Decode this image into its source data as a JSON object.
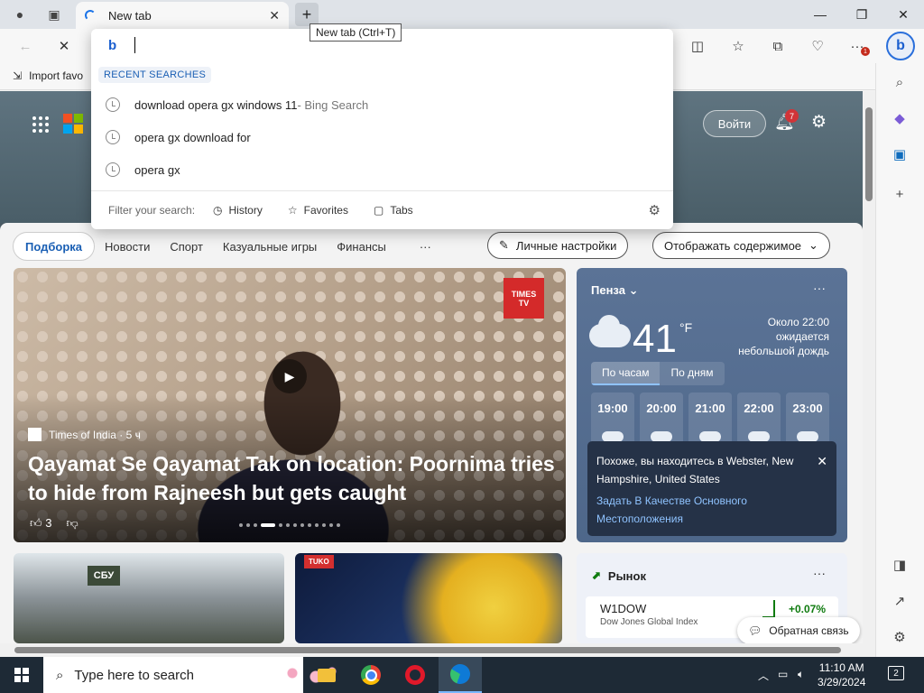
{
  "browser": {
    "tab_title": "New tab",
    "tooltip": "New tab (Ctrl+T)",
    "extensions_badge": "1"
  },
  "favorites_bar": {
    "import_label": "Import favo"
  },
  "omnibox": {
    "recent_heading": "RECENT SEARCHES",
    "suggestions": [
      {
        "text": "download opera gx windows 11",
        "suffix": " - Bing Search"
      },
      {
        "text": "opera gx download for",
        "suffix": ""
      },
      {
        "text": "opera gx",
        "suffix": ""
      }
    ],
    "filter_label": "Filter your search:",
    "filters": [
      "History",
      "Favorites",
      "Tabs"
    ]
  },
  "msn_header": {
    "signin_label": "Войти",
    "notification_count": "7"
  },
  "feed_nav": {
    "active": "Подборка",
    "items": [
      "Новости",
      "Спорт",
      "Казуальные игры",
      "Финансы"
    ],
    "more": "···",
    "personalize": "Личные настройки",
    "display_content": "Отображать содержимое"
  },
  "hero": {
    "badge_line1": "TIMES",
    "badge_line2": "TV",
    "source": "Times of India · 5 ч",
    "headline": "Qayamat Se Qayamat Tak on location: Poornima tries to hide from Rajneesh but gets caught",
    "likes": "3"
  },
  "weather": {
    "city": "Пенза",
    "temperature": "41",
    "unit": "°F",
    "forecast_line1": "Около 22:00",
    "forecast_line2": "ожидается",
    "forecast_line3": "небольшой дождь",
    "tab_hourly": "По часам",
    "tab_daily": "По дням",
    "hours": [
      "19:00",
      "20:00",
      "21:00",
      "22:00",
      "23:00"
    ],
    "popup_text": "Похоже, вы находитесь в Webster, New Hampshire, United States",
    "popup_link": "Задать В Качестве Основного Местоположения"
  },
  "cards": {
    "sbu_label": "СБУ",
    "tuko_label": "TUKO"
  },
  "market": {
    "title": "Рынок",
    "symbol": "W1DOW",
    "name": "Dow Jones Global Index",
    "change": "+0.07%"
  },
  "feedback_label": "Обратная связь",
  "taskbar": {
    "search_placeholder": "Type here to search",
    "time": "11:10 AM",
    "date": "3/29/2024",
    "notification_count": "2"
  },
  "colors": {
    "accent": "#1a5fb4",
    "taskbar": "#1e2a36",
    "weather_card": "#5b7396"
  }
}
